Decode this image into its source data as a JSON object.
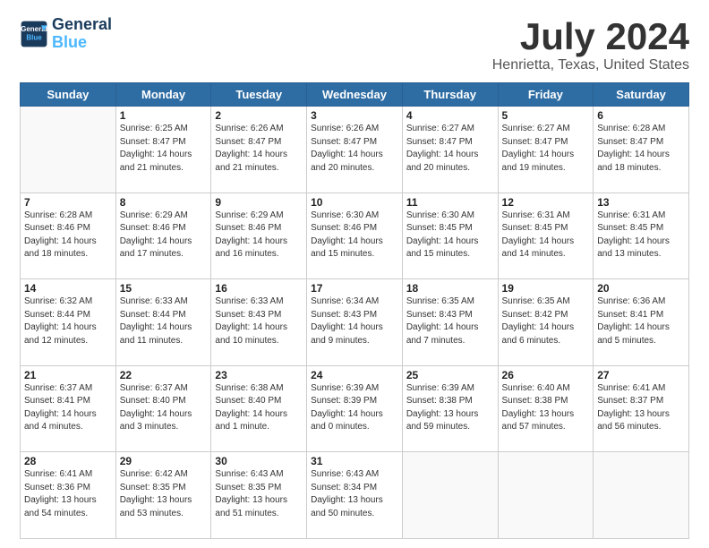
{
  "logo": {
    "line1": "General",
    "line2": "Blue"
  },
  "title": "July 2024",
  "location": "Henrietta, Texas, United States",
  "weekdays": [
    "Sunday",
    "Monday",
    "Tuesday",
    "Wednesday",
    "Thursday",
    "Friday",
    "Saturday"
  ],
  "weeks": [
    [
      {
        "day": "",
        "info": ""
      },
      {
        "day": "1",
        "info": "Sunrise: 6:25 AM\nSunset: 8:47 PM\nDaylight: 14 hours\nand 21 minutes."
      },
      {
        "day": "2",
        "info": "Sunrise: 6:26 AM\nSunset: 8:47 PM\nDaylight: 14 hours\nand 21 minutes."
      },
      {
        "day": "3",
        "info": "Sunrise: 6:26 AM\nSunset: 8:47 PM\nDaylight: 14 hours\nand 20 minutes."
      },
      {
        "day": "4",
        "info": "Sunrise: 6:27 AM\nSunset: 8:47 PM\nDaylight: 14 hours\nand 20 minutes."
      },
      {
        "day": "5",
        "info": "Sunrise: 6:27 AM\nSunset: 8:47 PM\nDaylight: 14 hours\nand 19 minutes."
      },
      {
        "day": "6",
        "info": "Sunrise: 6:28 AM\nSunset: 8:47 PM\nDaylight: 14 hours\nand 18 minutes."
      }
    ],
    [
      {
        "day": "7",
        "info": "Sunrise: 6:28 AM\nSunset: 8:46 PM\nDaylight: 14 hours\nand 18 minutes."
      },
      {
        "day": "8",
        "info": "Sunrise: 6:29 AM\nSunset: 8:46 PM\nDaylight: 14 hours\nand 17 minutes."
      },
      {
        "day": "9",
        "info": "Sunrise: 6:29 AM\nSunset: 8:46 PM\nDaylight: 14 hours\nand 16 minutes."
      },
      {
        "day": "10",
        "info": "Sunrise: 6:30 AM\nSunset: 8:46 PM\nDaylight: 14 hours\nand 15 minutes."
      },
      {
        "day": "11",
        "info": "Sunrise: 6:30 AM\nSunset: 8:45 PM\nDaylight: 14 hours\nand 15 minutes."
      },
      {
        "day": "12",
        "info": "Sunrise: 6:31 AM\nSunset: 8:45 PM\nDaylight: 14 hours\nand 14 minutes."
      },
      {
        "day": "13",
        "info": "Sunrise: 6:31 AM\nSunset: 8:45 PM\nDaylight: 14 hours\nand 13 minutes."
      }
    ],
    [
      {
        "day": "14",
        "info": "Sunrise: 6:32 AM\nSunset: 8:44 PM\nDaylight: 14 hours\nand 12 minutes."
      },
      {
        "day": "15",
        "info": "Sunrise: 6:33 AM\nSunset: 8:44 PM\nDaylight: 14 hours\nand 11 minutes."
      },
      {
        "day": "16",
        "info": "Sunrise: 6:33 AM\nSunset: 8:43 PM\nDaylight: 14 hours\nand 10 minutes."
      },
      {
        "day": "17",
        "info": "Sunrise: 6:34 AM\nSunset: 8:43 PM\nDaylight: 14 hours\nand 9 minutes."
      },
      {
        "day": "18",
        "info": "Sunrise: 6:35 AM\nSunset: 8:43 PM\nDaylight: 14 hours\nand 7 minutes."
      },
      {
        "day": "19",
        "info": "Sunrise: 6:35 AM\nSunset: 8:42 PM\nDaylight: 14 hours\nand 6 minutes."
      },
      {
        "day": "20",
        "info": "Sunrise: 6:36 AM\nSunset: 8:41 PM\nDaylight: 14 hours\nand 5 minutes."
      }
    ],
    [
      {
        "day": "21",
        "info": "Sunrise: 6:37 AM\nSunset: 8:41 PM\nDaylight: 14 hours\nand 4 minutes."
      },
      {
        "day": "22",
        "info": "Sunrise: 6:37 AM\nSunset: 8:40 PM\nDaylight: 14 hours\nand 3 minutes."
      },
      {
        "day": "23",
        "info": "Sunrise: 6:38 AM\nSunset: 8:40 PM\nDaylight: 14 hours\nand 1 minute."
      },
      {
        "day": "24",
        "info": "Sunrise: 6:39 AM\nSunset: 8:39 PM\nDaylight: 14 hours\nand 0 minutes."
      },
      {
        "day": "25",
        "info": "Sunrise: 6:39 AM\nSunset: 8:38 PM\nDaylight: 13 hours\nand 59 minutes."
      },
      {
        "day": "26",
        "info": "Sunrise: 6:40 AM\nSunset: 8:38 PM\nDaylight: 13 hours\nand 57 minutes."
      },
      {
        "day": "27",
        "info": "Sunrise: 6:41 AM\nSunset: 8:37 PM\nDaylight: 13 hours\nand 56 minutes."
      }
    ],
    [
      {
        "day": "28",
        "info": "Sunrise: 6:41 AM\nSunset: 8:36 PM\nDaylight: 13 hours\nand 54 minutes."
      },
      {
        "day": "29",
        "info": "Sunrise: 6:42 AM\nSunset: 8:35 PM\nDaylight: 13 hours\nand 53 minutes."
      },
      {
        "day": "30",
        "info": "Sunrise: 6:43 AM\nSunset: 8:35 PM\nDaylight: 13 hours\nand 51 minutes."
      },
      {
        "day": "31",
        "info": "Sunrise: 6:43 AM\nSunset: 8:34 PM\nDaylight: 13 hours\nand 50 minutes."
      },
      {
        "day": "",
        "info": ""
      },
      {
        "day": "",
        "info": ""
      },
      {
        "day": "",
        "info": ""
      }
    ]
  ]
}
